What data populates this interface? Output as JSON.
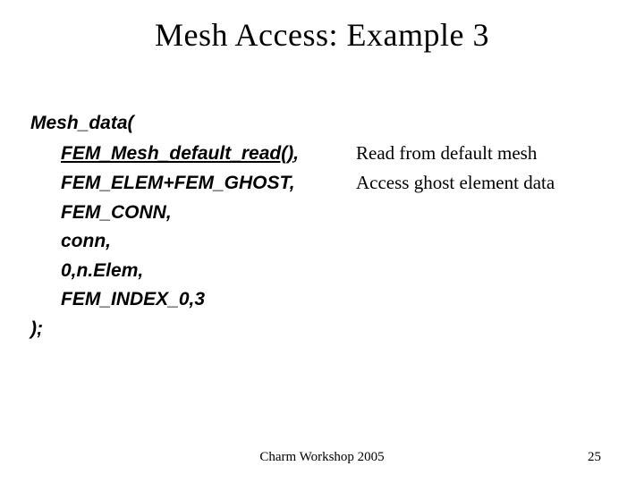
{
  "title": "Mesh Access: Example 3",
  "code": {
    "open": "Mesh_data(",
    "l1_pre": "FEM_Mesh_default_read()",
    "l1_post": ",",
    "l2": "FEM_ELEM+FEM_GHOST,",
    "l3": "FEM_CONN,",
    "l4": "conn,",
    "l5": "0,n.Elem,",
    "l6": "FEM_INDEX_0,3",
    "close": ");"
  },
  "annot": {
    "a1": "Read from default mesh",
    "a2": "Access ghost element data"
  },
  "footer": {
    "center": "Charm Workshop 2005",
    "page": "25"
  }
}
